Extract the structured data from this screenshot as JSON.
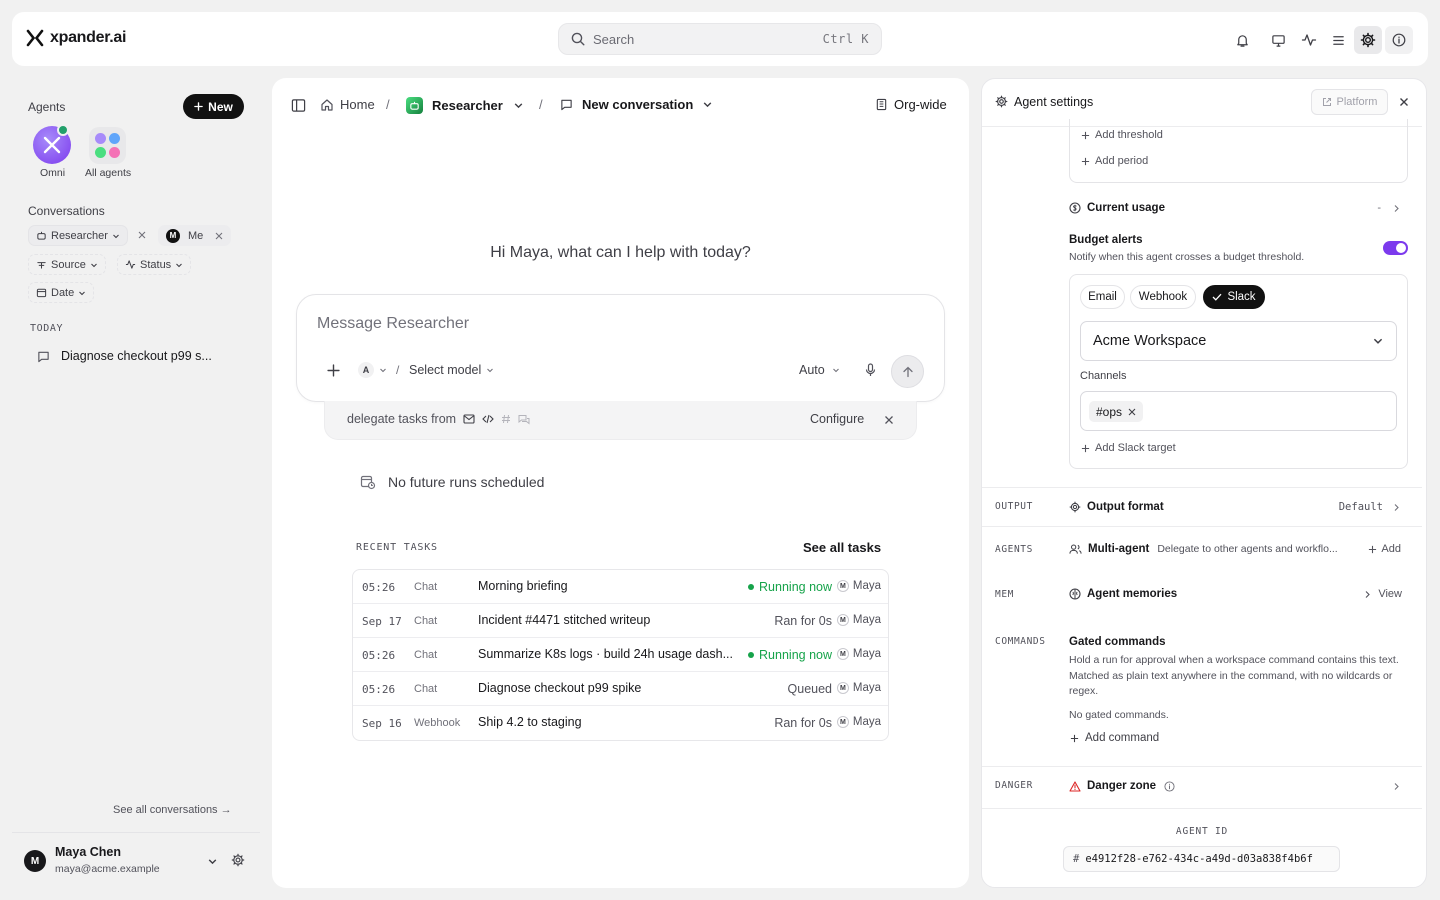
{
  "app": {
    "brand": "xpander.ai"
  },
  "search": {
    "placeholder": "Search",
    "shortcut": "Ctrl K"
  },
  "sidebar": {
    "agents_heading": "Agents",
    "new_button": "New",
    "agents": [
      {
        "label": "Omni"
      },
      {
        "label": "All agents"
      }
    ],
    "conversations_heading": "Conversations",
    "filters": {
      "agent": "Researcher",
      "user": "Me",
      "user_initial": "M",
      "source": "Source",
      "status": "Status",
      "date": "Date"
    },
    "today_label": "TODAY",
    "conversation_items": [
      {
        "title": "Diagnose checkout p99 s..."
      }
    ],
    "see_all": "See all conversations →",
    "user": {
      "initial": "M",
      "name": "Maya Chen",
      "email": "maya@acme.example"
    }
  },
  "center": {
    "breadcrumb": {
      "home": "Home",
      "agent": "Researcher",
      "conversation": "New conversation",
      "separator": "/"
    },
    "scope": "Org-wide",
    "greeting": "Hi Maya, what can I help with today?",
    "composer": {
      "placeholder": "Message Researcher",
      "model_badge": "A",
      "model_select": "Select model",
      "mode": "Auto",
      "separator": "/"
    },
    "delegate": {
      "text": "delegate tasks from",
      "configure": "Configure"
    },
    "schedule_empty": "No future runs scheduled",
    "recent_tasks_label": "RECENT TASKS",
    "see_all_tasks": "See all tasks",
    "tasks": [
      {
        "time": "05:26",
        "source": "Chat",
        "title": "Morning briefing",
        "status": "Running now",
        "running": true,
        "user": "Maya",
        "user_initial": "M"
      },
      {
        "time": "Sep 17",
        "source": "Chat",
        "title": "Incident #4471 stitched writeup",
        "status": "Ran for 0s",
        "running": false,
        "user": "Maya",
        "user_initial": "M"
      },
      {
        "time": "05:26",
        "source": "Chat",
        "title": "Summarize K8s logs · build 24h usage dash...",
        "status": "Running now",
        "running": true,
        "user": "Maya",
        "user_initial": "M"
      },
      {
        "time": "05:26",
        "source": "Chat",
        "title": "Diagnose checkout p99 spike",
        "status": "Queued",
        "running": false,
        "user": "Maya",
        "user_initial": "M"
      },
      {
        "time": "Sep 16",
        "source": "Webhook",
        "title": "Ship 4.2 to staging",
        "status": "Ran for 0s",
        "running": false,
        "user": "Maya",
        "user_initial": "M"
      }
    ]
  },
  "settings": {
    "title": "Agent settings",
    "platform_button": "Platform",
    "add_threshold": "Add threshold",
    "add_period": "Add period",
    "current_usage": {
      "label": "Current usage",
      "value": "-"
    },
    "budget_alerts": {
      "title": "Budget alerts",
      "description": "Notify when this agent crosses a budget threshold.",
      "enabled": true
    },
    "channels_tabs": [
      {
        "label": "Email"
      },
      {
        "label": "Webhook"
      },
      {
        "label": "Slack",
        "selected": true
      }
    ],
    "workspace_select": "Acme Workspace",
    "channels_label": "Channels",
    "channel_tag": "#ops",
    "add_slack_target": "Add Slack target",
    "output": {
      "section": "OUTPUT",
      "label": "Output format",
      "value": "Default"
    },
    "agents": {
      "section": "AGENTS",
      "label": "Multi-agent",
      "description": "Delegate to other agents and workflo...",
      "action": "Add"
    },
    "mem": {
      "section": "MEM",
      "label": "Agent memories",
      "action": "View"
    },
    "commands": {
      "section": "COMMANDS",
      "title": "Gated commands",
      "description": "Hold a run for approval when a workspace command contains this text. Matched as plain text anywhere in the command, with no wildcards or regex.",
      "empty": "No gated commands.",
      "add": "Add command"
    },
    "danger": {
      "section": "DANGER",
      "label": "Danger zone"
    },
    "agent_id": {
      "label": "AGENT ID",
      "prefix": "#",
      "value": "e4912f28-e762-434c-a49d-d03a838f4b6f"
    }
  },
  "colors": {
    "accent": "#7c3aed",
    "running": "#16a34a",
    "danger": "#dc2626"
  }
}
